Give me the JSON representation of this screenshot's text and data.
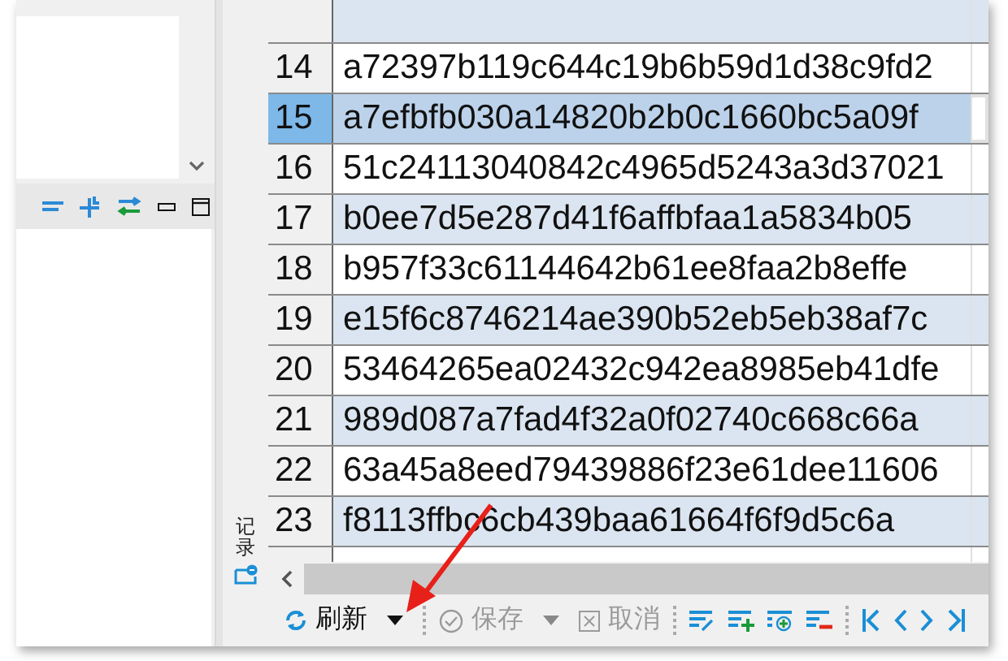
{
  "left_panel": {
    "toolbar": [
      {
        "kind": "collapse"
      },
      {
        "kind": "add"
      },
      {
        "kind": "swap"
      },
      {
        "kind": "minimize"
      },
      {
        "kind": "maximize"
      }
    ]
  },
  "grid": {
    "rows": [
      {
        "number": "14",
        "value": "a72397b119c644c19b6b59d1d38c9fd2",
        "selected": false
      },
      {
        "number": "15",
        "value": "a7efbfb030a14820b2b0c1660bc5a09f",
        "selected": true
      },
      {
        "number": "16",
        "value": "51c24113040842c4965d5243a3d37021",
        "selected": false
      },
      {
        "number": "17",
        "value": "b0ee7d5e287d41f6affbfaa1a5834b05",
        "selected": false
      },
      {
        "number": "18",
        "value": "b957f33c61144642b61ee8faa2b8effe",
        "selected": false
      },
      {
        "number": "19",
        "value": "e15f6c8746214ae390b52eb5eb38af7c",
        "selected": false
      },
      {
        "number": "20",
        "value": "53464265ea02432c942ea8985eb41dfe",
        "selected": false
      },
      {
        "number": "21",
        "value": "989d087a7fad4f32a0f02740c668c66a",
        "selected": false
      },
      {
        "number": "22",
        "value": "63a45a8eed79439886f23e61dee11606",
        "selected": false
      },
      {
        "number": "23",
        "value": "f8113ffbc6cb439baa61664f6f9d5c6a",
        "selected": false
      }
    ]
  },
  "side_tab": {
    "label": "记录"
  },
  "toolbar": [
    {
      "kind": "refresh",
      "label": "刷新",
      "disabled": false
    },
    {
      "kind": "dropdown",
      "disabled": false
    },
    {
      "kind": "separator"
    },
    {
      "kind": "save",
      "label": "保存",
      "disabled": true
    },
    {
      "kind": "dropdown",
      "disabled": true
    },
    {
      "kind": "cancel",
      "label": "取消",
      "disabled": true
    },
    {
      "kind": "separator"
    },
    {
      "kind": "edit-row"
    },
    {
      "kind": "add-row"
    },
    {
      "kind": "insert-row"
    },
    {
      "kind": "delete-row"
    },
    {
      "kind": "separator"
    },
    {
      "kind": "first"
    },
    {
      "kind": "prev"
    },
    {
      "kind": "next"
    },
    {
      "kind": "last"
    }
  ]
}
